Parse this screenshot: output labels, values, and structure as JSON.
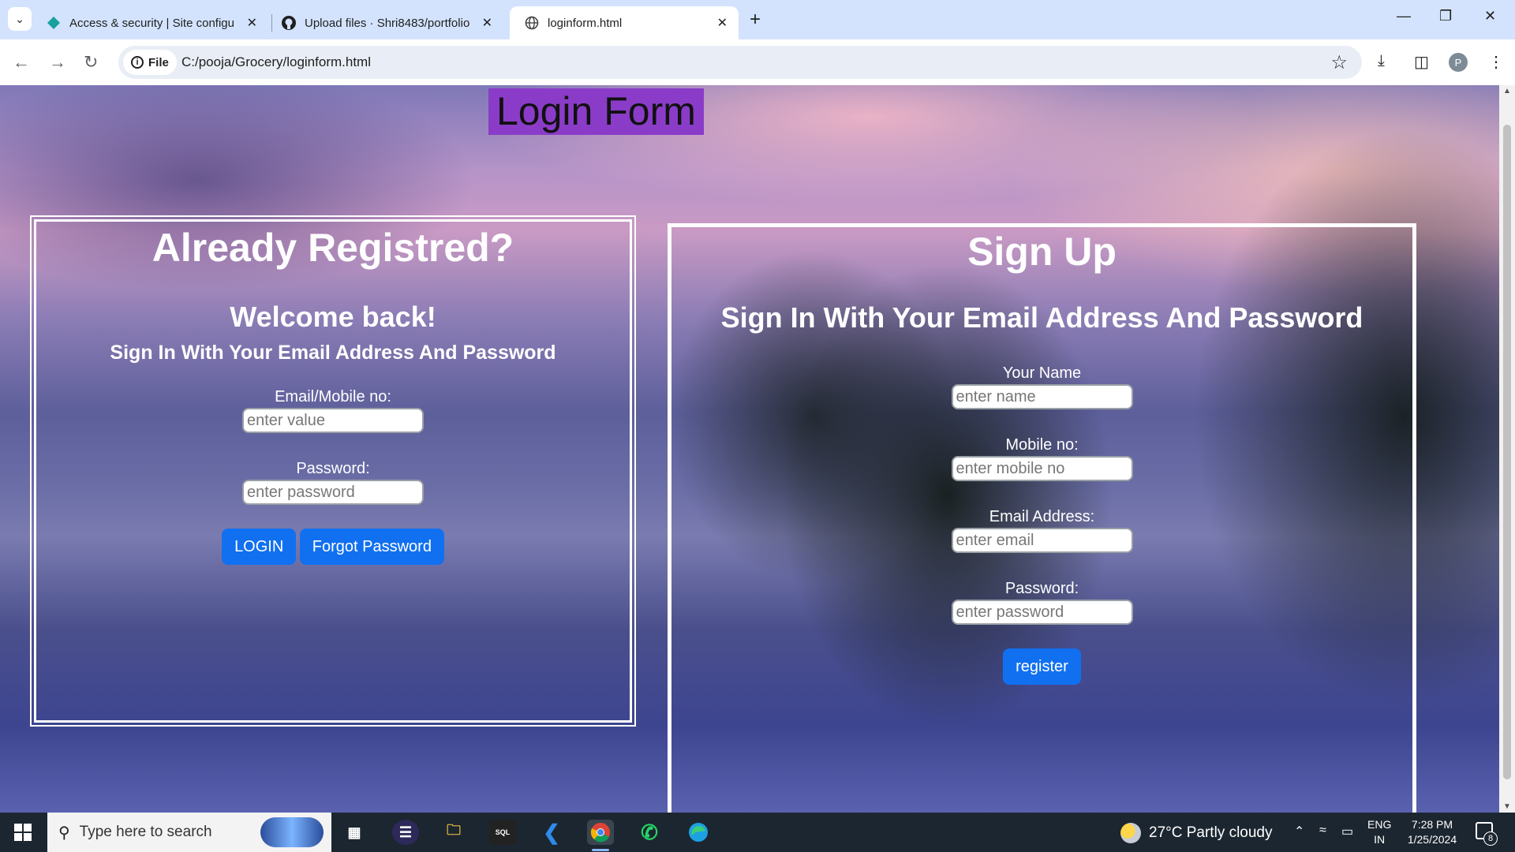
{
  "browser": {
    "tabs": [
      {
        "title": "Access & security | Site configu",
        "active": false,
        "icon": "diamond-teal-icon"
      },
      {
        "title": "Upload files · Shri8483/portfolio",
        "active": false,
        "icon": "github-icon"
      },
      {
        "title": "loginform.html",
        "active": true,
        "icon": "globe-icon"
      }
    ],
    "url_chip": "File",
    "url": "C:/pooja/Grocery/loginform.html",
    "profile_initial": "P"
  },
  "page": {
    "title": "Login Form",
    "login": {
      "heading": "Already Registred?",
      "welcome": "Welcome back!",
      "subheading": "Sign In With Your Email Address And Password",
      "email_label": "Email/Mobile no:",
      "email_placeholder": "enter value",
      "password_label": "Password:",
      "password_placeholder": "enter password",
      "login_button": "LOGIN",
      "forgot_button": "Forgot Password"
    },
    "signup": {
      "heading": "Sign Up",
      "subheading": "Sign In With Your Email Address And Password",
      "name_label": "Your Name",
      "name_placeholder": "enter name",
      "mobile_label": "Mobile no:",
      "mobile_placeholder": "enter mobile no",
      "email_label": "Email Address:",
      "email_placeholder": "enter email",
      "password_label": "Password:",
      "password_placeholder": "enter password",
      "register_button": "register"
    }
  },
  "taskbar": {
    "search_placeholder": "Type here to search",
    "weather": "27°C  Partly cloudy",
    "lang_line1": "ENG",
    "lang_line2": "IN",
    "time": "7:28 PM",
    "date": "1/25/2024",
    "notification_count": "8"
  },
  "colors": {
    "title_bg": "#8a3cc8",
    "button_blue": "#1170f0",
    "tabstrip": "#d3e3fd",
    "taskbar": "#1c2630"
  }
}
